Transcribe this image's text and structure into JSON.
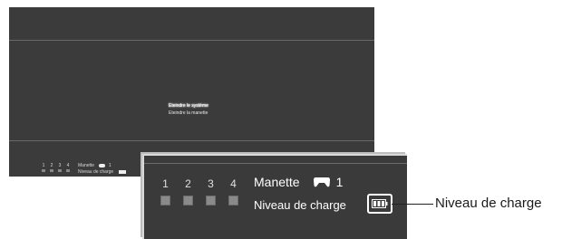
{
  "screen": {
    "menu": [
      {
        "label": "Eteindre le système",
        "selected": true
      },
      {
        "label": "Eteindre la manette",
        "selected": false
      }
    ],
    "status": {
      "ports": [
        "1",
        "2",
        "3",
        "4"
      ],
      "controller_label": "Manette",
      "controller_number": "1",
      "charge_label": "Niveau de charge"
    }
  },
  "zoom": {
    "ports": [
      "1",
      "2",
      "3",
      "4"
    ],
    "controller_label": "Manette",
    "controller_number": "1",
    "charge_label": "Niveau de charge",
    "battery_level": 1.0
  },
  "callout": {
    "label": "Niveau de charge"
  },
  "colors": {
    "screen_bg": "#3b3b3b",
    "text": "#ffffff",
    "port_square": "#8a8a8a"
  }
}
